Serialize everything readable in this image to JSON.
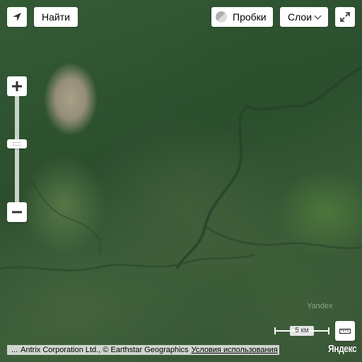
{
  "map": {
    "type": "satellite",
    "watermark": "Yandex"
  },
  "toolbar": {
    "find_label": "Найти",
    "traffic_label": "Пробки",
    "layers_label": "Слои"
  },
  "scale": {
    "label": "5 км"
  },
  "copyright": {
    "more": "...",
    "text": "Antrix Corporation Ltd., © Earthstar Geographics",
    "terms_label": "Условия использования"
  },
  "logo": {
    "text": "Яндекс"
  },
  "icons": {
    "geolocation": "arrow-icon",
    "fullscreen": "expand-icon",
    "zoom_in": "plus-icon",
    "zoom_out": "minus-icon",
    "ruler": "ruler-icon",
    "traffic": "traffic-circle-icon"
  }
}
